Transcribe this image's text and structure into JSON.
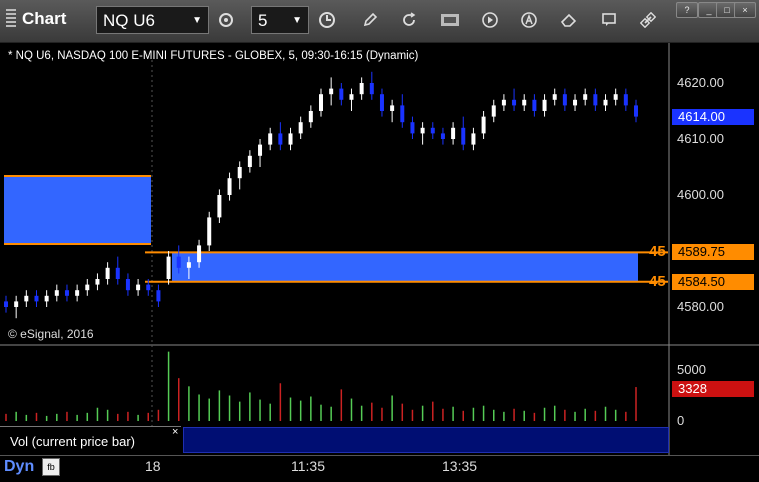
{
  "window": {
    "title": "Chart"
  },
  "toolbar": {
    "symbol": "NQ U6",
    "interval": "5",
    "icons": [
      "gear-icon",
      "clock-icon",
      "pencil-icon",
      "refresh-icon",
      "get-icon",
      "play-icon",
      "a-icon",
      "eraser-icon",
      "chat-icon",
      "link-icon"
    ]
  },
  "chart": {
    "instrument_label": "* NQ U6, NASDAQ 100 E-MINI FUTURES - GLOBEX, 5, 09:30-16:15 (Dynamic)",
    "copyright": "© eSignal, 2016",
    "price_ticks": [
      "4620.00",
      "4610.00",
      "4600.00",
      "4580.00"
    ],
    "last_price": "4614.00",
    "order_levels": [
      {
        "qty": "45",
        "price": "4589.75"
      },
      {
        "qty": "45",
        "price": "4584.50"
      }
    ],
    "volume": {
      "ticks": [
        "5000",
        "0"
      ],
      "current": "3328",
      "label": "Vol (current price bar)"
    },
    "time_labels": [
      "18",
      "11:35",
      "13:35"
    ],
    "dyn_label": "Dyn",
    "colors": {
      "up": "#ffffff",
      "down": "#1a33ff",
      "zone": "#3366ff",
      "level": "#ff8c00",
      "vol_up": "#55cc55",
      "vol_down": "#cc2222"
    }
  },
  "chart_data": {
    "type": "candlestick",
    "title": "* NQ U6, NASDAQ 100 E-MINI FUTURES - GLOBEX, 5, 09:30-16:15 (Dynamic)",
    "ylim": [
      4575,
      4625
    ],
    "x_tick_labels": [
      "18",
      "11:35",
      "13:35"
    ],
    "last": 4614.0,
    "levels": [
      4589.75,
      4584.5
    ],
    "ohlc": [
      [
        4581,
        4582,
        4579,
        4580
      ],
      [
        4580,
        4582,
        4578,
        4581
      ],
      [
        4581,
        4583,
        4580,
        4582
      ],
      [
        4582,
        4583,
        4580,
        4581
      ],
      [
        4581,
        4583,
        4580,
        4582
      ],
      [
        4582,
        4584,
        4581,
        4583
      ],
      [
        4583,
        4584,
        4581,
        4582
      ],
      [
        4582,
        4584,
        4581,
        4583
      ],
      [
        4583,
        4585,
        4582,
        4584
      ],
      [
        4584,
        4586,
        4583,
        4585
      ],
      [
        4585,
        4588,
        4584,
        4587
      ],
      [
        4587,
        4589,
        4584,
        4585
      ],
      [
        4585,
        4586,
        4582,
        4583
      ],
      [
        4583,
        4585,
        4582,
        4584
      ],
      [
        4584,
        4585,
        4582,
        4583
      ],
      [
        4583,
        4584,
        4580,
        4581
      ],
      [
        4585,
        4590,
        4584,
        4589
      ],
      [
        4589,
        4591,
        4586,
        4587
      ],
      [
        4587,
        4589,
        4585,
        4588
      ],
      [
        4588,
        4592,
        4587,
        4591
      ],
      [
        4591,
        4597,
        4590,
        4596
      ],
      [
        4596,
        4601,
        4595,
        4600
      ],
      [
        4600,
        4604,
        4599,
        4603
      ],
      [
        4603,
        4606,
        4601,
        4605
      ],
      [
        4605,
        4608,
        4604,
        4607
      ],
      [
        4607,
        4610,
        4605,
        4609
      ],
      [
        4609,
        4612,
        4608,
        4611
      ],
      [
        4611,
        4613,
        4608,
        4609
      ],
      [
        4609,
        4612,
        4608,
        4611
      ],
      [
        4611,
        4614,
        4610,
        4613
      ],
      [
        4613,
        4616,
        4612,
        4615
      ],
      [
        4615,
        4619,
        4614,
        4618
      ],
      [
        4618,
        4621,
        4616,
        4619
      ],
      [
        4619,
        4620,
        4616,
        4617
      ],
      [
        4617,
        4619,
        4615,
        4618
      ],
      [
        4618,
        4621,
        4617,
        4620
      ],
      [
        4620,
        4622,
        4617,
        4618
      ],
      [
        4618,
        4619,
        4614,
        4615
      ],
      [
        4615,
        4617,
        4613,
        4616
      ],
      [
        4616,
        4618,
        4612,
        4613
      ],
      [
        4613,
        4614,
        4610,
        4611
      ],
      [
        4611,
        4613,
        4609,
        4612
      ],
      [
        4612,
        4613,
        4610,
        4611
      ],
      [
        4611,
        4612,
        4609,
        4610
      ],
      [
        4610,
        4613,
        4609,
        4612
      ],
      [
        4612,
        4614,
        4608,
        4609
      ],
      [
        4609,
        4612,
        4608,
        4611
      ],
      [
        4611,
        4615,
        4610,
        4614
      ],
      [
        4614,
        4617,
        4613,
        4616
      ],
      [
        4616,
        4618,
        4615,
        4617
      ],
      [
        4617,
        4619,
        4615,
        4616
      ],
      [
        4616,
        4618,
        4615,
        4617
      ],
      [
        4617,
        4618,
        4614,
        4615
      ],
      [
        4615,
        4618,
        4614,
        4617
      ],
      [
        4617,
        4619,
        4616,
        4618
      ],
      [
        4618,
        4619,
        4615,
        4616
      ],
      [
        4616,
        4618,
        4615,
        4617
      ],
      [
        4617,
        4619,
        4616,
        4618
      ],
      [
        4618,
        4619,
        4615,
        4616
      ],
      [
        4616,
        4618,
        4615,
        4617
      ],
      [
        4617,
        4619,
        4616,
        4618
      ],
      [
        4618,
        4619,
        4615,
        4616
      ],
      [
        4616,
        4617,
        4613,
        4614
      ]
    ],
    "volume": [
      700,
      900,
      600,
      800,
      500,
      700,
      900,
      600,
      800,
      1300,
      1100,
      700,
      900,
      600,
      800,
      1100,
      6800,
      4200,
      3400,
      2600,
      2200,
      3000,
      2500,
      1900,
      2800,
      2100,
      1700,
      3700,
      2300,
      2000,
      2400,
      1600,
      1400,
      3100,
      2200,
      1500,
      1800,
      1300,
      2500,
      1700,
      1100,
      1500,
      1900,
      1200,
      1400,
      1000,
      1300,
      1500,
      1100,
      900,
      1200,
      1000,
      800,
      1300,
      1500,
      1100,
      900,
      1200,
      1000,
      1400,
      1100,
      900,
      3328
    ]
  }
}
